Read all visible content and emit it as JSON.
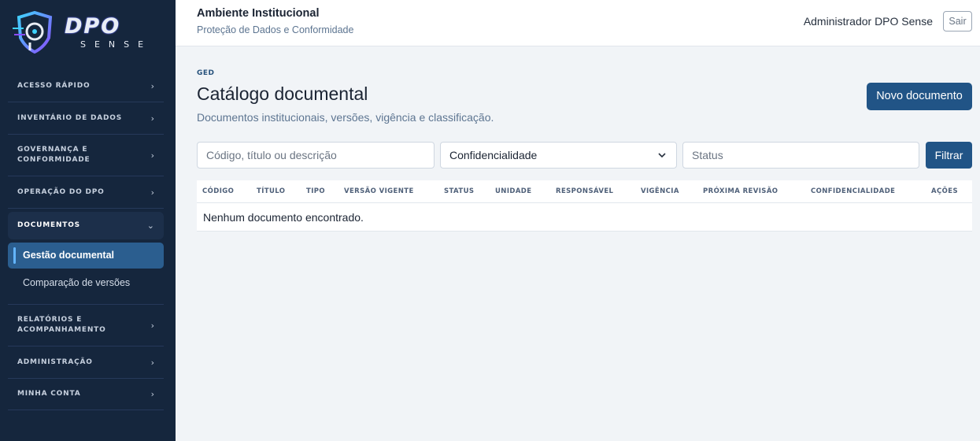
{
  "brand": {
    "name": "DPO",
    "tagline": "SENSE"
  },
  "sidebar": {
    "items": [
      {
        "label": "ACESSO RÁPIDO",
        "chevron": "›"
      },
      {
        "label": "INVENTÁRIO DE DADOS",
        "chevron": "›"
      },
      {
        "label": "GOVERNANÇA E CONFORMIDADE",
        "chevron": "›"
      },
      {
        "label": "OPERAÇÃO DO DPO",
        "chevron": "›"
      },
      {
        "label": "DOCUMENTOS",
        "chevron": "⌄"
      },
      {
        "label": "RELATÓRIOS E ACOMPANHAMENTO",
        "chevron": "›"
      },
      {
        "label": "ADMINISTRAÇÃO",
        "chevron": "›"
      },
      {
        "label": "MINHA CONTA",
        "chevron": "›"
      }
    ],
    "documentos_sub": [
      {
        "label": "Gestão documental"
      },
      {
        "label": "Comparação de versões"
      }
    ]
  },
  "header": {
    "title": "Ambiente Institucional",
    "subtitle": "Proteção de Dados e Conformidade",
    "user": "Administrador DPO Sense",
    "logout": "Sair"
  },
  "main": {
    "eyebrow": "GED",
    "title": "Catálogo documental",
    "description": "Documentos institucionais, versões, vigência e classificação.",
    "new_button": "Novo documento",
    "filters": {
      "search_placeholder": "Código, título ou descrição",
      "confidentiality": "Confidencialidade",
      "status_placeholder": "Status",
      "filter_button": "Filtrar"
    },
    "table": {
      "columns": [
        "CÓDIGO",
        "TÍTULO",
        "TIPO",
        "VERSÃO VIGENTE",
        "STATUS",
        "UNIDADE",
        "RESPONSÁVEL",
        "VIGÊNCIA",
        "PRÓXIMA REVISÃO",
        "CONFIDENCIALIDADE",
        "AÇÕES"
      ],
      "empty_message": "Nenhum documento encontrado."
    }
  },
  "colors": {
    "sidebar": "#15263d",
    "accent": "#215486",
    "active": "#2b5e8f"
  }
}
